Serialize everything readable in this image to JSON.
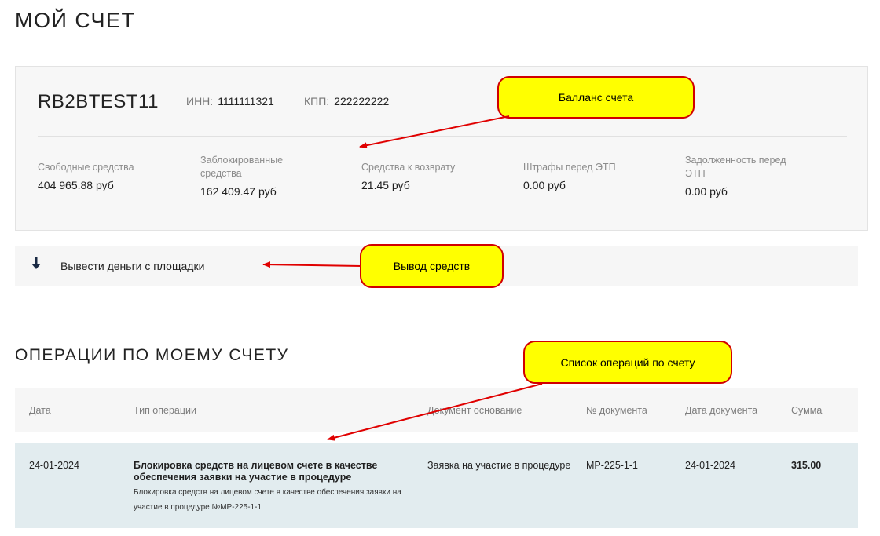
{
  "page_title": "МОЙ СЧЕТ",
  "account": {
    "name": "RB2BTEST11",
    "inn_label": "ИНН:",
    "inn_value": "1111111321",
    "kpp_label": "КПП:",
    "kpp_value": "222222222"
  },
  "balances": [
    {
      "label": "Свободные средства",
      "value": "404 965.88 руб"
    },
    {
      "label": "Заблокированные средства",
      "value": "162 409.47 руб"
    },
    {
      "label": "Средства к возврату",
      "value": "21.45 руб"
    },
    {
      "label": "Штрафы перед ЭТП",
      "value": "0.00 руб"
    },
    {
      "label": "Задолженность перед ЭТП",
      "value": "0.00 руб"
    }
  ],
  "withdraw": {
    "label": "Вывести деньги с площадки",
    "icon": "arrow-down-icon"
  },
  "operations": {
    "title": "ОПЕРАЦИИ ПО МОЕМУ СЧЕТУ",
    "columns": [
      "Дата",
      "Тип операции",
      "Документ основание",
      "№ документа",
      "Дата документа",
      "Сумма"
    ],
    "rows": [
      {
        "date": "24-01-2024",
        "type_main": "Блокировка средств на лицевом счете в качестве обеспечения заявки на участие в процедуре",
        "type_sub": "Блокировка средств на лицевом счете в качестве обеспечения заявки на участие в процедуре №МР-225-1-1",
        "basis": "Заявка на участие в процедуре",
        "doc_no": "МР-225-1-1",
        "doc_date": "24-01-2024",
        "sum": "315.00"
      }
    ]
  },
  "callouts": {
    "balance": "Балланс счета",
    "withdraw": "Вывод средств",
    "operations": "Список операций по счету"
  },
  "colors": {
    "callout_fill": "#ffff00",
    "callout_border": "#d10000",
    "arrow": "#e00000",
    "row_highlight": "#e2ecef"
  }
}
